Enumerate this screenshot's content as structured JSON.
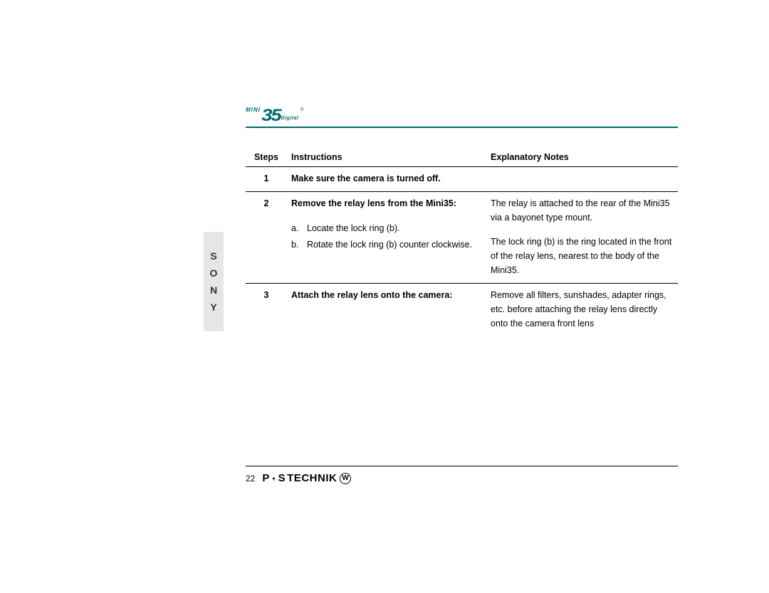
{
  "sidebar": {
    "letters": [
      "S",
      "O",
      "N",
      "Y"
    ]
  },
  "logo": {
    "mini": "MINI",
    "number": "35",
    "digital": "Digital",
    "reg": "®"
  },
  "table": {
    "headers": {
      "steps": "Steps",
      "instructions": "Instructions",
      "notes": "Explanatory Notes"
    },
    "rows": {
      "r1": {
        "num": "1",
        "instruction": "Make sure the camera is turned off.",
        "notes": ""
      },
      "r2": {
        "num": "2",
        "instruction": "Remove the relay lens from the Mini35:",
        "sub_a_letter": "a.",
        "sub_a_text": "Locate the lock ring (b).",
        "sub_b_letter": "b.",
        "sub_b_text": "Rotate the lock ring (b) counter clockwise.",
        "notes_top": "The relay is attached to the rear of the Mini35 via a bayonet type mount.",
        "notes_bottom": "The lock ring (b) is the  ring located in the front of the relay lens, nearest to the body of the Mini35."
      },
      "r3": {
        "num": "3",
        "instruction": "Attach the relay lens onto the camera:",
        "notes": "Remove all filters, sunshades, adapter rings, etc. before attaching the relay lens directly onto the camera front lens"
      }
    }
  },
  "footer": {
    "page_number": "22",
    "brand_p": "P",
    "brand_plus": "+",
    "brand_s": "S",
    "brand_technik": " TECHNIK",
    "brand_w": "W"
  }
}
